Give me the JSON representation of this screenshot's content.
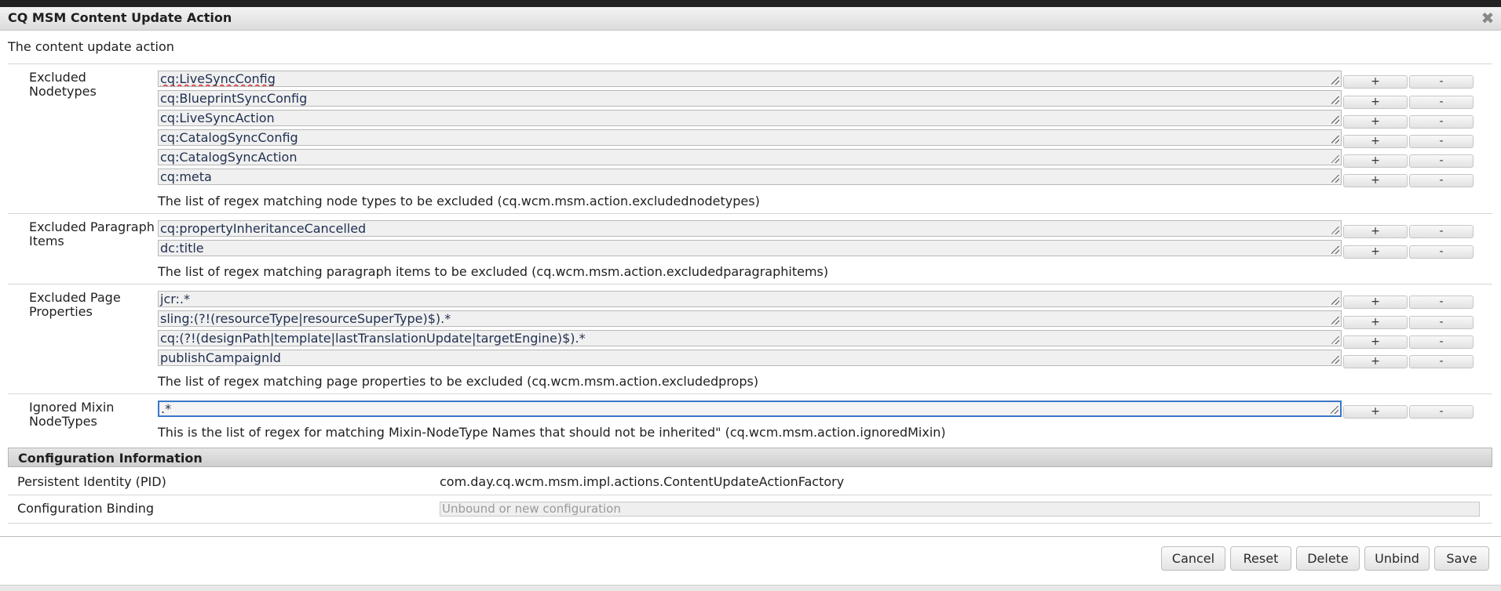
{
  "window": {
    "title": "CQ MSM Content Update Action",
    "close_icon": "close-icon"
  },
  "description": "The content update action",
  "sections": [
    {
      "label": "Excluded Nodetypes",
      "values": [
        "cq:LiveSyncConfig",
        "cq:BlueprintSyncConfig",
        "cq:LiveSyncAction",
        "cq:CatalogSyncConfig",
        "cq:CatalogSyncAction",
        "cq:meta"
      ],
      "help": "The list of regex matching node types to be excluded (cq.wcm.msm.action.excludednodetypes)"
    },
    {
      "label": "Excluded Paragraph Items",
      "values": [
        "cq:propertyInheritanceCancelled",
        "dc:title"
      ],
      "help": "The list of regex matching paragraph items to be excluded (cq.wcm.msm.action.excludedparagraphitems)"
    },
    {
      "label": "Excluded Page Properties",
      "values": [
        "jcr:.*",
        "sling:(?!(resourceType|resourceSuperType)$).*",
        "cq:(?!(designPath|template|lastTranslationUpdate|targetEngine)$).*",
        "publishCampaignId"
      ],
      "help": "The list of regex matching page properties to be excluded (cq.wcm.msm.action.excludedprops)"
    },
    {
      "label": "Ignored Mixin NodeTypes",
      "values": [
        ".*"
      ],
      "help": "This is the list of regex for matching Mixin-NodeType Names that should not be inherited\" (cq.wcm.msm.action.ignoredMixin)"
    }
  ],
  "row_buttons": {
    "add": "+",
    "remove": "-"
  },
  "config_info": {
    "header": "Configuration Information",
    "pid_label": "Persistent Identity (PID)",
    "pid_value": "com.day.cq.wcm.msm.impl.actions.ContentUpdateActionFactory",
    "binding_label": "Configuration Binding",
    "binding_placeholder": "Unbound or new configuration"
  },
  "footer": {
    "cancel": "Cancel",
    "reset": "Reset",
    "delete": "Delete",
    "unbind": "Unbind",
    "save": "Save"
  },
  "colors": {
    "focus_border": "#3a76c9",
    "field_bg": "#f0f0f0"
  }
}
